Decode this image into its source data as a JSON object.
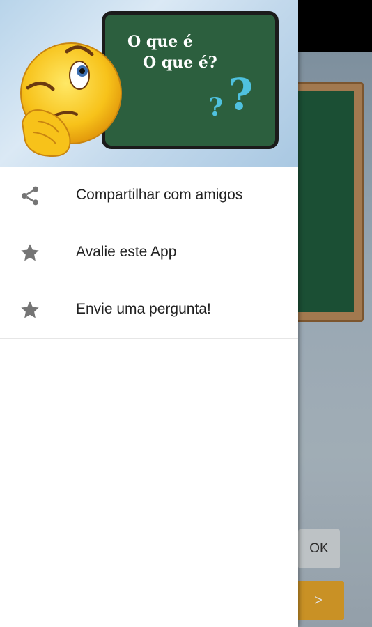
{
  "background_app": {
    "ok_button_label": "OK",
    "next_button_label": ">"
  },
  "drawer": {
    "header": {
      "line1": "O que é",
      "line2": "O que é?",
      "question_marks": [
        "?",
        "?"
      ]
    },
    "menu": [
      {
        "label": "Compartilhar com amigos",
        "icon": "share-icon"
      },
      {
        "label": "Avalie este App",
        "icon": "star-icon"
      },
      {
        "label": "Envie uma pergunta!",
        "icon": "star-icon"
      }
    ]
  },
  "colors": {
    "chalkboard": "#2c5f3e",
    "question_mark": "#4fc1df",
    "icon_gray": "#757575",
    "ok_button": "#d8dde1",
    "next_button": "#e5a52b"
  }
}
